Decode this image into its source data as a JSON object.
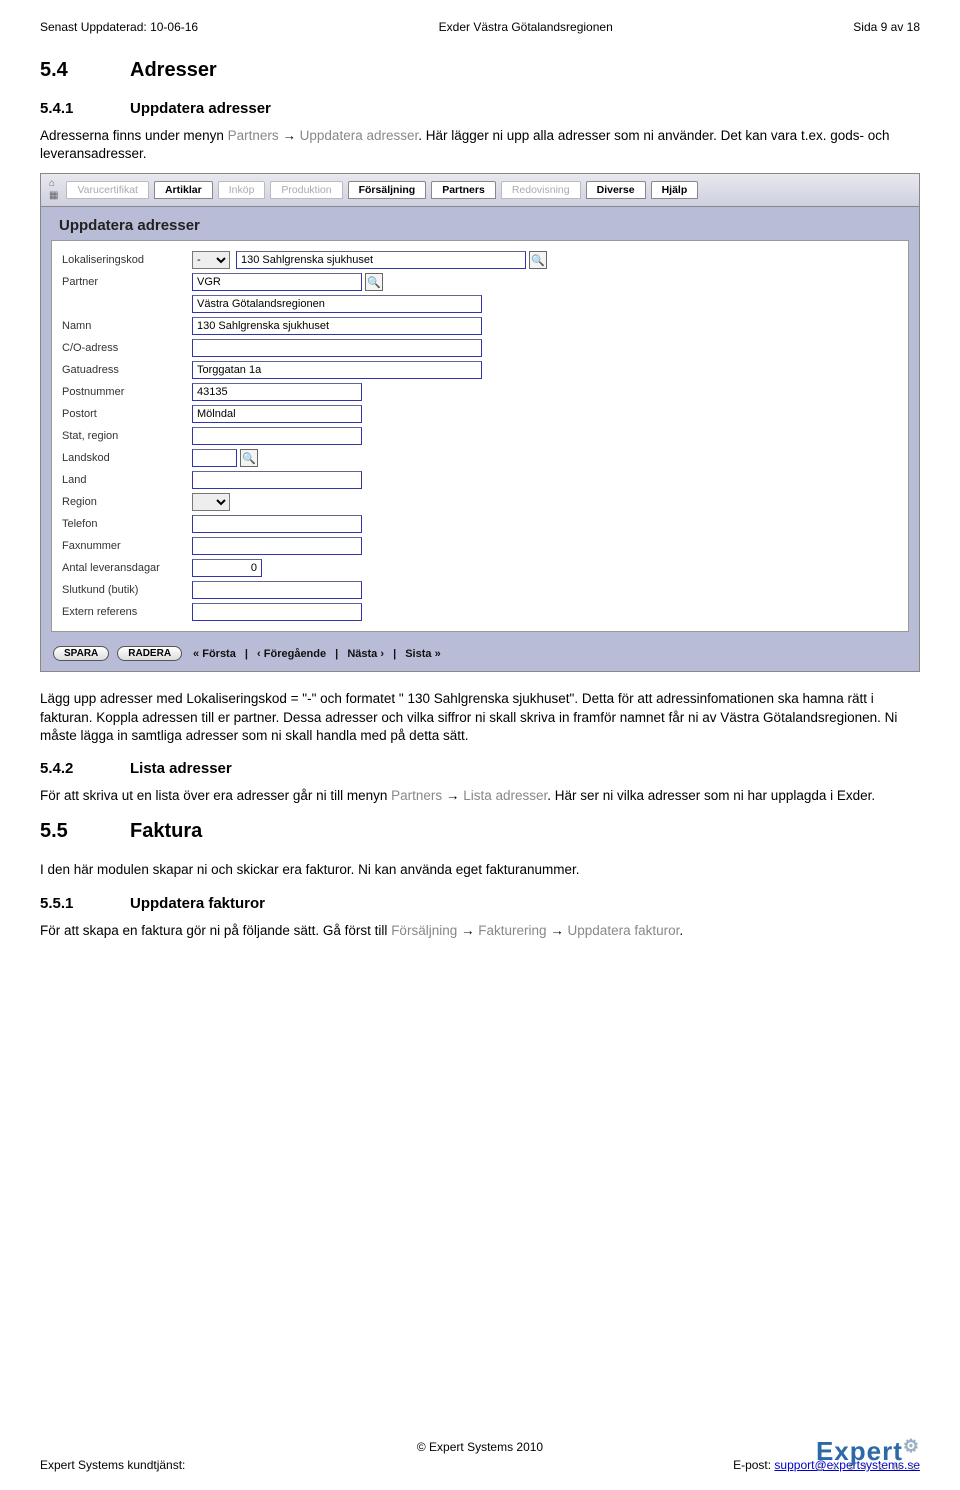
{
  "header": {
    "left": "Senast Uppdaterad: 10-06-16",
    "center": "Exder Västra Götalandsregionen",
    "right": "Sida 9 av 18"
  },
  "s54": {
    "num": "5.4",
    "title": "Adresser"
  },
  "s541": {
    "num": "5.4.1",
    "title": "Uppdatera adresser",
    "p1a": "Adresserna finns under menyn ",
    "p1grey1": "Partners",
    "p1arrow": " → ",
    "p1grey2": "Uppdatera adresser",
    "p1b": ". Här lägger ni upp alla adresser som ni använder. Det kan vara t.ex. gods- och leveransadresser."
  },
  "app": {
    "tabs": [
      "Varucertifikat",
      "Artiklar",
      "Inköp",
      "Produktion",
      "Försäljning",
      "Partners",
      "Redovisning",
      "Diverse",
      "Hjälp"
    ],
    "tabs_dim": [
      true,
      false,
      true,
      true,
      false,
      false,
      true,
      false,
      false
    ],
    "panel_title": "Uppdatera adresser",
    "rows": {
      "lokaliseringskod_label": "Lokaliseringskod",
      "lokaliseringskod_select": "-",
      "lokaliseringskod_input": "130 Sahlgrenska sjukhuset",
      "partner_label": "Partner",
      "partner_code": "VGR",
      "partner_name": "Västra Götalandsregionen",
      "namn_label": "Namn",
      "namn_val": "130 Sahlgrenska sjukhuset",
      "co_label": "C/O-adress",
      "gatu_label": "Gatuadress",
      "gatu_val": "Torggatan 1a",
      "postnr_label": "Postnummer",
      "postnr_val": "43135",
      "postort_label": "Postort",
      "postort_val": "Mölndal",
      "stat_label": "Stat, region",
      "landskod_label": "Landskod",
      "land_label": "Land",
      "region_label": "Region",
      "telefon_label": "Telefon",
      "fax_label": "Faxnummer",
      "levdagar_label": "Antal leveransdagar",
      "levdagar_val": "0",
      "slutkund_label": "Slutkund (butik)",
      "extref_label": "Extern referens"
    },
    "buttons": {
      "spara": "SPARA",
      "radera": "RADERA"
    },
    "nav": {
      "forsta": "« Första",
      "foregaende": "‹ Föregående",
      "nasta": "Nästa ›",
      "sista": "Sista »",
      "sep": " | "
    }
  },
  "after": {
    "p2": "Lägg upp adresser med Lokaliseringskod = \"-\" och formatet \" 130 Sahlgrenska sjukhuset\". Detta för att adressinfomationen ska hamna rätt i fakturan. Koppla adressen till er partner. Dessa adresser och vilka siffror ni skall skriva in framför namnet får ni av Västra Götalandsregionen. Ni måste lägga in samtliga adresser som ni skall handla med på detta sätt."
  },
  "s542": {
    "num": "5.4.2",
    "title": "Lista adresser",
    "p_a": "För att skriva ut en lista över era adresser går ni till menyn ",
    "grey1": "Partners",
    "arrow": " → ",
    "grey2": "Lista adresser",
    "p_b": ". Här ser ni vilka adresser som ni har upplagda i Exder."
  },
  "s55": {
    "num": "5.5",
    "title": "Faktura",
    "p": "I den här modulen skapar ni och skickar era fakturor. Ni kan använda eget fakturanummer."
  },
  "s551": {
    "num": "5.5.1",
    "title": "Uppdatera fakturor",
    "p_a": "För att skapa en faktura gör ni på följande sätt. Gå först till ",
    "grey1": "Försäljning",
    "arrow1": " → ",
    "grey2": "Fakturering",
    "arrow2": " → ",
    "grey3": "Uppdatera fakturor",
    "p_b": "."
  },
  "footer": {
    "copyright": "© Expert Systems 2010",
    "left": "Expert Systems kundtjänst:",
    "right_label": "E-post: ",
    "right_link": "support@expertsystems.se",
    "logo_main": "Expert",
    "logo_sub": "S Y S T E M S"
  }
}
